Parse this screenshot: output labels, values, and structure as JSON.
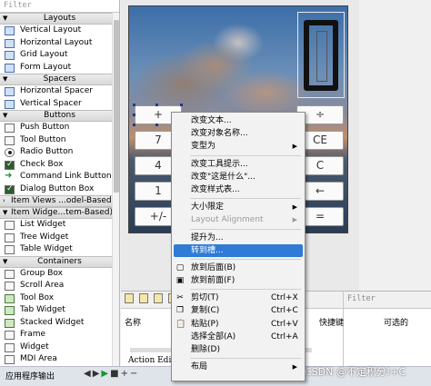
{
  "widgetbox": {
    "filter_placeholder": "Filter",
    "categories": {
      "layouts": "Layouts",
      "spacers": "Spacers",
      "buttons": "Buttons",
      "item_views": "Item Views ...odel-Based)",
      "item_widgets": "Item Widge...tem-Based)",
      "containers": "Containers"
    },
    "layouts": [
      "Vertical Layout",
      "Horizontal Layout",
      "Grid Layout",
      "Form Layout"
    ],
    "spacers": [
      "Horizontal Spacer",
      "Vertical Spacer"
    ],
    "buttons": [
      "Push Button",
      "Tool Button",
      "Radio Button",
      "Check Box",
      "Command Link Button",
      "Dialog Button Box"
    ],
    "item_widgets": [
      "List Widget",
      "Tree Widget",
      "Table Widget"
    ],
    "containers": [
      "Group Box",
      "Scroll Area",
      "Tool Box",
      "Tab Widget",
      "Stacked Widget",
      "Frame",
      "Widget",
      "MDI Area"
    ]
  },
  "form": {
    "keys": {
      "plus": "+",
      "divide": "÷",
      "seven": "7",
      "ce": "CE",
      "four": "4",
      "c": "C",
      "one": "1",
      "back": "←",
      "plusminus": "+/-",
      "equals": "="
    }
  },
  "context_menu": {
    "items": [
      {
        "label": "改变文本...",
        "shortcut": "",
        "submenu": false,
        "disabled": false
      },
      {
        "label": "改变对象名称...",
        "shortcut": "",
        "submenu": false,
        "disabled": false
      },
      {
        "label": "变型为",
        "shortcut": "",
        "submenu": true,
        "disabled": false
      },
      {
        "label": "改变工具提示...",
        "shortcut": "",
        "submenu": false,
        "disabled": false
      },
      {
        "label": "改变\"这是什么\"...",
        "shortcut": "",
        "submenu": false,
        "disabled": false
      },
      {
        "label": "改变样式表...",
        "shortcut": "",
        "submenu": false,
        "disabled": false
      },
      {
        "label": "大小限定",
        "shortcut": "",
        "submenu": true,
        "disabled": false
      },
      {
        "label": "Layout Alignment",
        "shortcut": "",
        "submenu": true,
        "disabled": true
      },
      {
        "label": "提升为...",
        "shortcut": "",
        "submenu": false,
        "disabled": false
      },
      {
        "label": "转到槽...",
        "shortcut": "",
        "submenu": false,
        "disabled": false,
        "highlighted": true
      },
      {
        "label": "放到后面(B)",
        "shortcut": "",
        "submenu": false,
        "disabled": false
      },
      {
        "label": "放到前面(F)",
        "shortcut": "",
        "submenu": false,
        "disabled": false
      },
      {
        "label": "剪切(T)",
        "shortcut": "Ctrl+X",
        "submenu": false,
        "disabled": false
      },
      {
        "label": "复制(C)",
        "shortcut": "Ctrl+C",
        "submenu": false,
        "disabled": false
      },
      {
        "label": "粘贴(P)",
        "shortcut": "Ctrl+V",
        "submenu": false,
        "disabled": false
      },
      {
        "label": "选择全部(A)",
        "shortcut": "Ctrl+A",
        "submenu": false,
        "disabled": false
      },
      {
        "label": "删除(D)",
        "shortcut": "",
        "submenu": false,
        "disabled": false
      },
      {
        "label": "布局",
        "shortcut": "",
        "submenu": true,
        "disabled": false
      }
    ]
  },
  "action_editor": {
    "column_name": "名称",
    "tab_label": "Action Edi"
  },
  "property_pane": {
    "filter_placeholder": "Filter",
    "column_shortcut": "快捷键",
    "column_checkable": "可选的"
  },
  "statusbar": {
    "label": "应用程序输出"
  },
  "watermark": "CSDN @不定积分!+C",
  "colors": {
    "menu_highlight": "#2f7bd6",
    "selection": "#1f3a93"
  }
}
